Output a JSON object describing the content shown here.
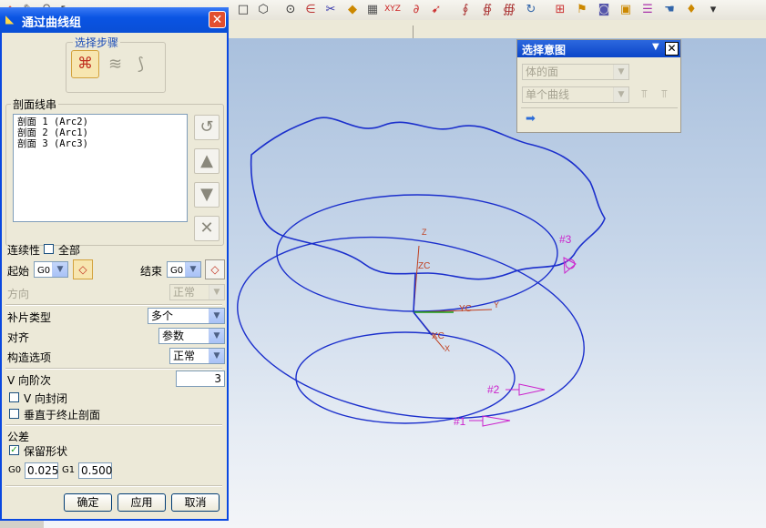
{
  "toolbar": {
    "icons": [
      "home-icon",
      "edit-icon",
      "pin-icon",
      "cursor-icon",
      "rectangle-icon",
      "hexagon-icon",
      "circle-icon",
      "fillet-icon",
      "trim-icon",
      "sphere-icon",
      "block-icon",
      "xyz-icon",
      "curve-icon",
      "arrow-icon",
      "sweep-icon",
      "sweep2-icon",
      "sweep3-icon",
      "rotate-icon",
      "mesh-icon",
      "flag-icon",
      "camera-icon",
      "box-icon",
      "layers-icon",
      "hand-icon",
      "more-icon"
    ]
  },
  "dialog": {
    "title": "通过曲线组",
    "steps_label": "选择步骤",
    "section_group_label": "剖面线串",
    "sections": [
      "剖面 1 (Arc2)",
      "剖面 2 (Arc1)",
      "剖面 3 (Arc3)"
    ],
    "continuity_label": "连续性",
    "all_label": "全部",
    "all_checked": false,
    "start_label": "起始",
    "start_value": "G0",
    "end_label": "结束",
    "end_value": "G0",
    "direction_label": "方向",
    "direction_value": "正常",
    "patch_type_label": "补片类型",
    "patch_type_value": "多个",
    "alignment_label": "对齐",
    "alignment_value": "参数",
    "construct_label": "构造选项",
    "construct_value": "正常",
    "v_degree_label": "V 向阶次",
    "v_degree_value": "3",
    "v_closed_label": "V 向封闭",
    "v_closed_checked": false,
    "perp_label": "垂直于终止剖面",
    "perp_checked": false,
    "tolerance_label": "公差",
    "keep_shape_label": "保留形状",
    "keep_shape_checked": true,
    "g0_label": "G0",
    "g0_value": "0.025",
    "g1_label": "G1",
    "g1_value": "0.500",
    "ok_label": "确定",
    "apply_label": "应用",
    "cancel_label": "取消"
  },
  "intent_panel": {
    "title": "选择意图",
    "face_rule": "体的面",
    "curve_rule": "单个曲线"
  },
  "viewport": {
    "labels": {
      "sec1": "#1",
      "sec2": "#2",
      "sec3": "#3",
      "axis_zc": "ZC",
      "axis_z": "Z",
      "axis_xc": "XC",
      "axis_x": "X",
      "axis_yc": "YC",
      "axis_y": "Y"
    },
    "colors": {
      "curve": "#1b2fcc",
      "marker": "#cc22cc",
      "axis_red": "#c04020",
      "axis_green": "#18a018"
    }
  }
}
